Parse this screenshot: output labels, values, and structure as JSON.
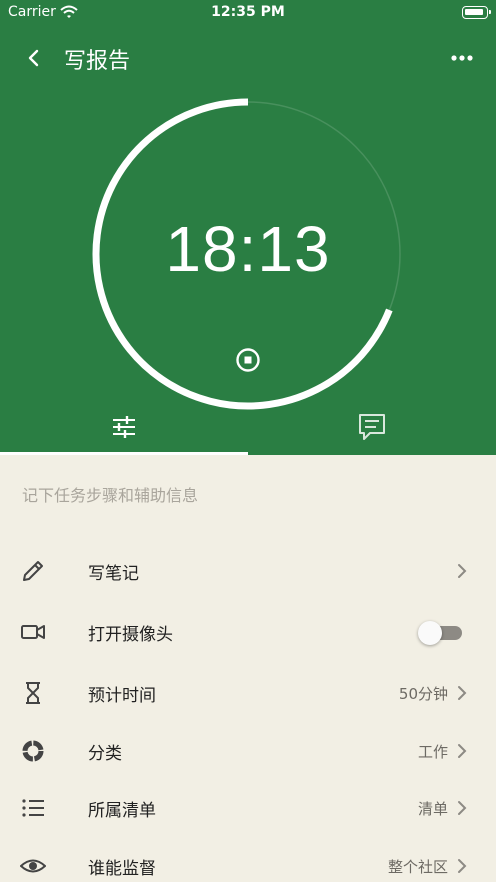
{
  "status_bar": {
    "carrier": "Carrier",
    "time": "12:35 PM"
  },
  "nav": {
    "title": "写报告",
    "back_icon": "chevron-left-icon",
    "more_icon": "more-icon"
  },
  "timer": {
    "display": "18:13",
    "progress": 0.69
  },
  "tabs": [
    {
      "icon": "sliders-icon",
      "selected": true
    },
    {
      "icon": "comments-icon",
      "selected": false
    }
  ],
  "hint": "记下任务步骤和辅助信息",
  "rows": [
    {
      "icon": "pencil-icon",
      "label": "写笔记",
      "value": ""
    },
    {
      "icon": "video-camera-icon",
      "label": "打开摄像头",
      "toggle": false
    },
    {
      "icon": "hourglass-icon",
      "label": "预计时间",
      "value": "50分钟"
    },
    {
      "icon": "category-icon",
      "label": "分类",
      "value": "工作"
    },
    {
      "icon": "list-icon",
      "label": "所属清单",
      "value": "清单"
    },
    {
      "icon": "eye-icon",
      "label": "谁能监督",
      "value": "整个社区"
    }
  ],
  "colors": {
    "primary_green": "#2a7e43",
    "background": "#f2efe4"
  }
}
